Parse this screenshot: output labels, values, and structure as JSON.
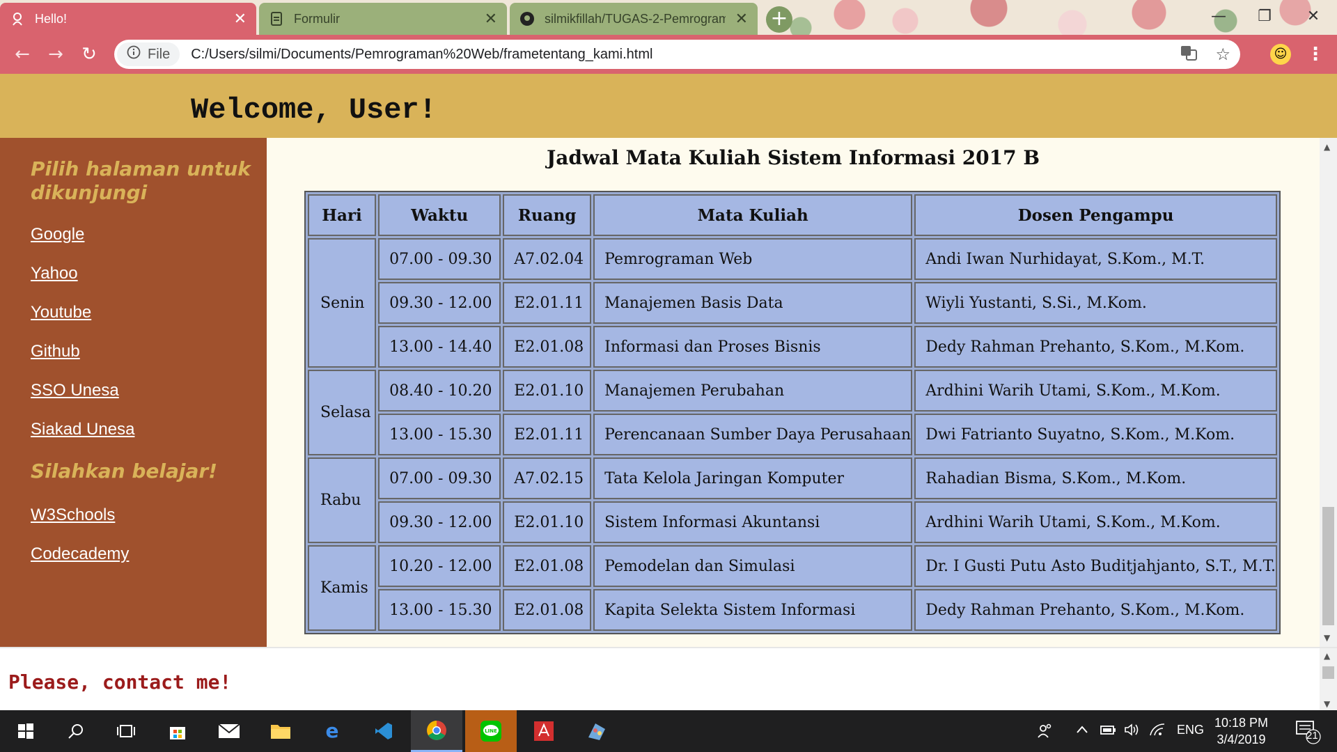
{
  "browser": {
    "tabs": [
      {
        "label": "Hello!",
        "icon": "red-avatar-icon"
      },
      {
        "label": "Formulir",
        "icon": "document-icon"
      },
      {
        "label": "silmikfillah/TUGAS-2-Pemrogram",
        "icon": "github-icon"
      }
    ],
    "close_glyph": "✕",
    "new_tab_glyph": "+",
    "site_info_label": "File",
    "url": "C:/Users/silmi/Documents/Pemrograman%20Web/frametentang_kami.html"
  },
  "header": {
    "title": "Welcome, User!"
  },
  "sidebar": {
    "heading1": "Pilih halaman untuk dikunjungi",
    "links1": [
      "Google",
      "Yahoo",
      "Youtube",
      "Github",
      "SSO Unesa",
      "Siakad Unesa"
    ],
    "heading2": "Silahkan belajar!",
    "links2": [
      "W3Schools",
      "Codecademy"
    ]
  },
  "main": {
    "title": "Jadwal Mata Kuliah Sistem Informasi 2017 B",
    "table": {
      "headers": [
        "Hari",
        "Waktu",
        "Ruang",
        "Mata Kuliah",
        "Dosen Pengampu"
      ],
      "rows": [
        {
          "day": "Senin",
          "time": "07.00 - 09.30",
          "room": "A7.02.04",
          "course": "Pemrograman Web",
          "lecturer": "Andi Iwan Nurhidayat, S.Kom., M.T."
        },
        {
          "time": "09.30 - 12.00",
          "room": "E2.01.11",
          "course": "Manajemen Basis Data",
          "lecturer": "Wiyli Yustanti, S.Si., M.Kom."
        },
        {
          "time": "13.00 - 14.40",
          "room": "E2.01.08",
          "course": "Informasi dan Proses Bisnis",
          "lecturer": "Dedy Rahman Prehanto, S.Kom., M.Kom."
        },
        {
          "day": "Selasa",
          "time": "08.40 - 10.20",
          "room": "E2.01.10",
          "course": "Manajemen Perubahan",
          "lecturer": "Ardhini Warih Utami, S.Kom., M.Kom."
        },
        {
          "time": "13.00 - 15.30",
          "room": "E2.01.11",
          "course": "Perencanaan Sumber Daya Perusahaan",
          "lecturer": "Dwi Fatrianto Suyatno, S.Kom., M.Kom."
        },
        {
          "day": "Rabu",
          "time": "07.00 - 09.30",
          "room": "A7.02.15",
          "course": "Tata Kelola Jaringan Komputer",
          "lecturer": "Rahadian Bisma, S.Kom., M.Kom."
        },
        {
          "time": "09.30 - 12.00",
          "room": "E2.01.10",
          "course": "Sistem Informasi Akuntansi",
          "lecturer": "Ardhini Warih Utami, S.Kom., M.Kom."
        },
        {
          "day": "Kamis",
          "time": "10.20 - 12.00",
          "room": "E2.01.08",
          "course": "Pemodelan dan Simulasi",
          "lecturer": "Dr. I Gusti Putu Asto Buditjahjanto, S.T., M.T."
        },
        {
          "time": "13.00 - 15.30",
          "room": "E2.01.08",
          "course": "Kapita Selekta Sistem Informasi",
          "lecturer": "Dedy Rahman Prehanto, S.Kom., M.Kom."
        }
      ]
    }
  },
  "footer": {
    "text": "Please, contact me!"
  },
  "taskbar": {
    "apps": [
      "start-icon",
      "search-icon",
      "task-view-icon",
      "store-icon",
      "mail-icon",
      "file-explorer-icon",
      "edge-icon",
      "vscode-icon",
      "chrome-icon",
      "line-icon",
      "acrobat-icon",
      "paint-icon"
    ],
    "language": "ENG",
    "time": "10:18 PM",
    "date": "3/4/2019",
    "notification_count": "21"
  },
  "colors": {
    "tab_active": "#d9636e",
    "header_bg": "#d9b359",
    "sidebar_bg": "#a0512d",
    "main_bg": "#fefbee",
    "table_cell": "#a5b7e3",
    "footer_text": "#9b1b1b"
  }
}
